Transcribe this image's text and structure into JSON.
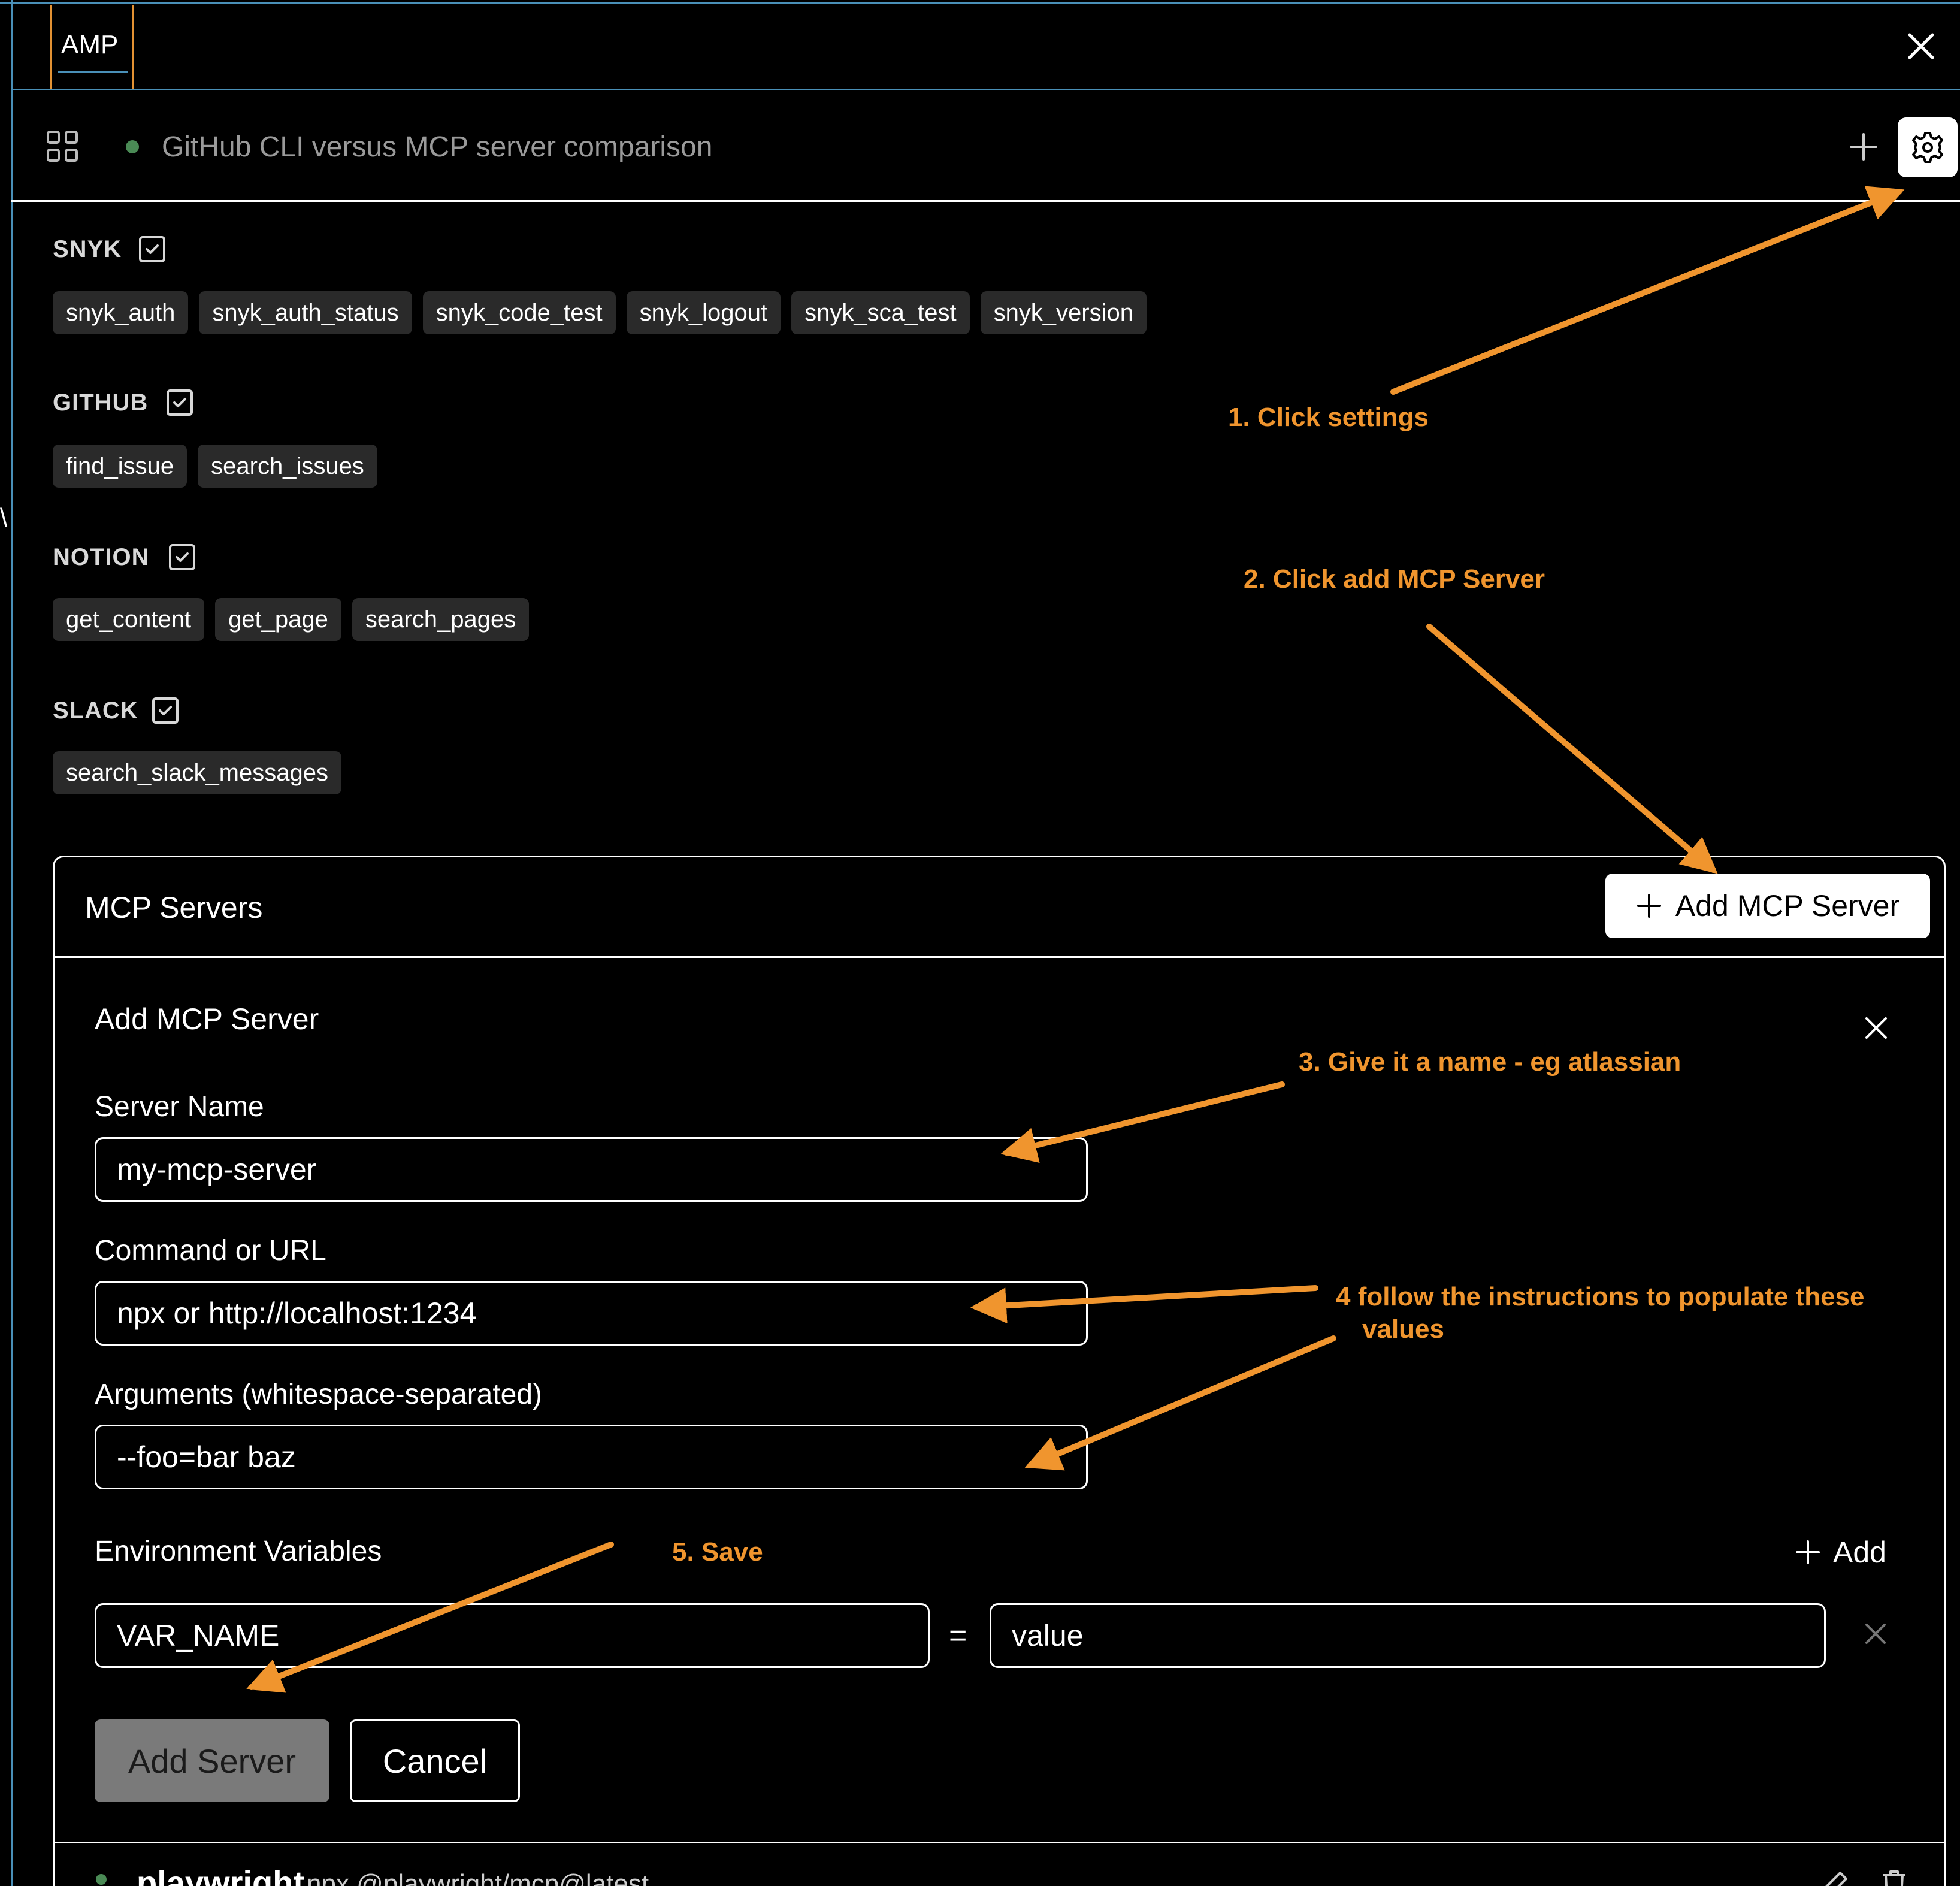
{
  "app": {
    "tab_label": "AMP",
    "close_icon": "close-icon"
  },
  "thread": {
    "title": "GitHub CLI versus MCP server comparison",
    "status_color": "#4a8a55",
    "grid_icon": "grid-icon",
    "new_icon": "plus-icon",
    "settings_icon": "gear-icon"
  },
  "tool_groups": [
    {
      "name": "SNYK",
      "enabled": true,
      "tools": [
        "snyk_auth",
        "snyk_auth_status",
        "snyk_code_test",
        "snyk_logout",
        "snyk_sca_test",
        "snyk_version"
      ]
    },
    {
      "name": "GITHUB",
      "enabled": true,
      "tools": [
        "find_issue",
        "search_issues"
      ]
    },
    {
      "name": "NOTION",
      "enabled": true,
      "tools": [
        "get_content",
        "get_page",
        "search_pages"
      ]
    },
    {
      "name": "SLACK",
      "enabled": true,
      "tools": [
        "search_slack_messages"
      ]
    }
  ],
  "mcp_panel": {
    "title": "MCP Servers",
    "add_button": "Add MCP Server",
    "form": {
      "title": "Add MCP Server",
      "server_name_label": "Server Name",
      "server_name_placeholder": "my-mcp-server",
      "command_label": "Command or URL",
      "command_placeholder": "npx or http://localhost:1234",
      "args_label": "Arguments (whitespace-separated)",
      "args_placeholder": "--foo=bar baz",
      "env_label": "Environment Variables",
      "env_add": "Add",
      "env_name_placeholder": "VAR_NAME",
      "env_equals": "=",
      "env_value_placeholder": "value",
      "submit": "Add Server",
      "cancel": "Cancel"
    },
    "servers": [
      {
        "name": "playwright",
        "command": "npx @playwright/mcp@latest",
        "status_color": "#4a8a55"
      }
    ]
  },
  "annotations": {
    "color": "#f0952e",
    "step1": "1. Click settings",
    "step2": "2. Click add MCP Server",
    "step3": "3. Give it a name - eg atlassian",
    "step4_line1": "4  follow the instructions to populate these",
    "step4_line2": "values",
    "step5": "5. Save"
  }
}
